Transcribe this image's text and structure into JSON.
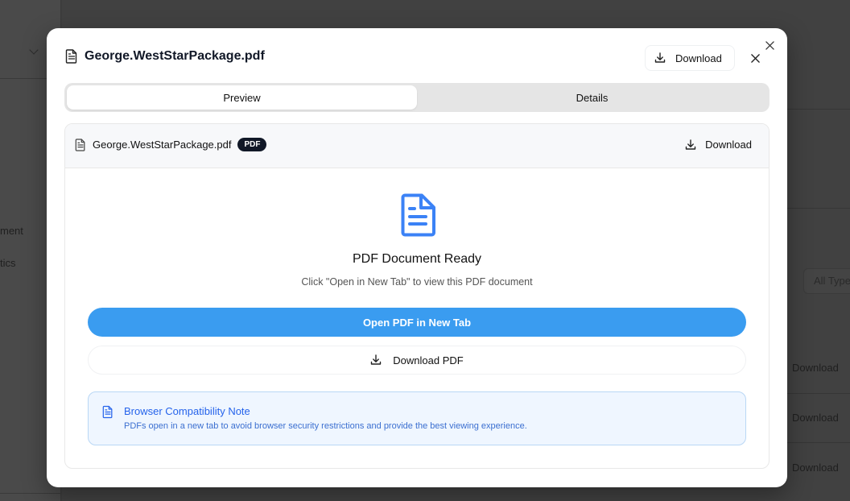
{
  "background": {
    "sidebar_items": [
      "ment",
      "tics"
    ],
    "filter_label": "All Type",
    "row_actions": [
      "Download",
      "Download",
      "Download"
    ]
  },
  "modal": {
    "title": "George.WestStarPackage.pdf",
    "header_download_label": "Download",
    "tabs": [
      {
        "label": "Preview",
        "active": true
      },
      {
        "label": "Details",
        "active": false
      }
    ],
    "file": {
      "name": "George.WestStarPackage.pdf",
      "type_badge": "PDF",
      "download_label": "Download"
    },
    "preview": {
      "title": "PDF Document Ready",
      "subtitle": "Click \"Open in New Tab\" to view this PDF document",
      "open_button_label": "Open PDF in New Tab",
      "download_button_label": "Download PDF"
    },
    "note": {
      "title": "Browser Compatibility Note",
      "body": "PDFs open in a new tab to avoid browser security restrictions and provide the best viewing experience."
    }
  },
  "colors": {
    "accent": "#3a9cf0",
    "icon_blue": "#3b82f6",
    "note_bg": "#eff6ff",
    "note_text": "#2563eb",
    "badge_bg": "#111827",
    "overlay": "#3e3e3e"
  },
  "icons": {
    "file": "file-text-icon",
    "download": "download-icon",
    "close": "close-icon",
    "chevron": "chevron-down-icon"
  }
}
